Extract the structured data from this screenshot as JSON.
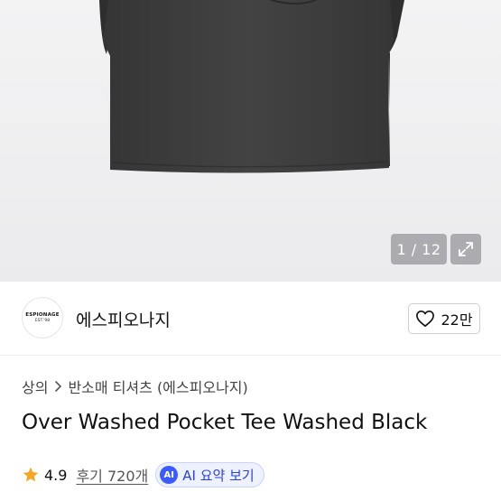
{
  "gallery": {
    "pager": "1 / 12",
    "expand_icon": "expand-icon"
  },
  "brand": {
    "logo_text_top": "ESPIONAGE",
    "logo_text_bottom": "EST.'98",
    "name": "에스피오나지",
    "likes": "22만",
    "like_icon": "heart-outline-icon"
  },
  "breadcrumb": {
    "level1": "상의",
    "level2": "반소매 티셔츠 (에스피오나지)"
  },
  "product": {
    "title": "Over Washed Pocket Tee Washed Black",
    "rating": "4.9",
    "reviews": "후기 720개",
    "ai_badge": "AI",
    "ai_summary": "AI 요약 보기"
  },
  "colors": {
    "accent": "#3b5bfd",
    "star": "#f5a623",
    "shirt": "#3a3a3b"
  }
}
